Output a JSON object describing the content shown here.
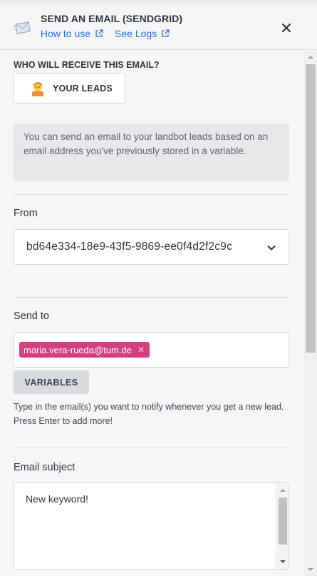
{
  "header": {
    "title": "SEND AN EMAIL (SENDGRID)",
    "links": [
      {
        "label": "How to use"
      },
      {
        "label": "See Logs"
      }
    ]
  },
  "recipients": {
    "section_label": "WHO WILL RECEIVE THIS EMAIL?",
    "leads_button_label": "YOUR LEADS",
    "info_text": "You can send an email to your landbot leads based on an email address you've previously stored in a variable."
  },
  "from": {
    "label": "From",
    "selected_value": "bd64e334-18e9-43f5-9869-ee0f4d2f2c9c"
  },
  "send_to": {
    "label": "Send to",
    "tags": [
      {
        "value": "maria.vera-rueda@tum.de"
      }
    ],
    "variables_button": "VARIABLES",
    "help_text": "Type in the email(s) you want to notify whenever you get a new lead. Press Enter to add more!"
  },
  "email_subject": {
    "label": "Email subject",
    "value": "New keyword!"
  },
  "colors": {
    "link": "#2a6ee6",
    "tag": "#d43f83",
    "info_bg": "#e7e8ea"
  }
}
